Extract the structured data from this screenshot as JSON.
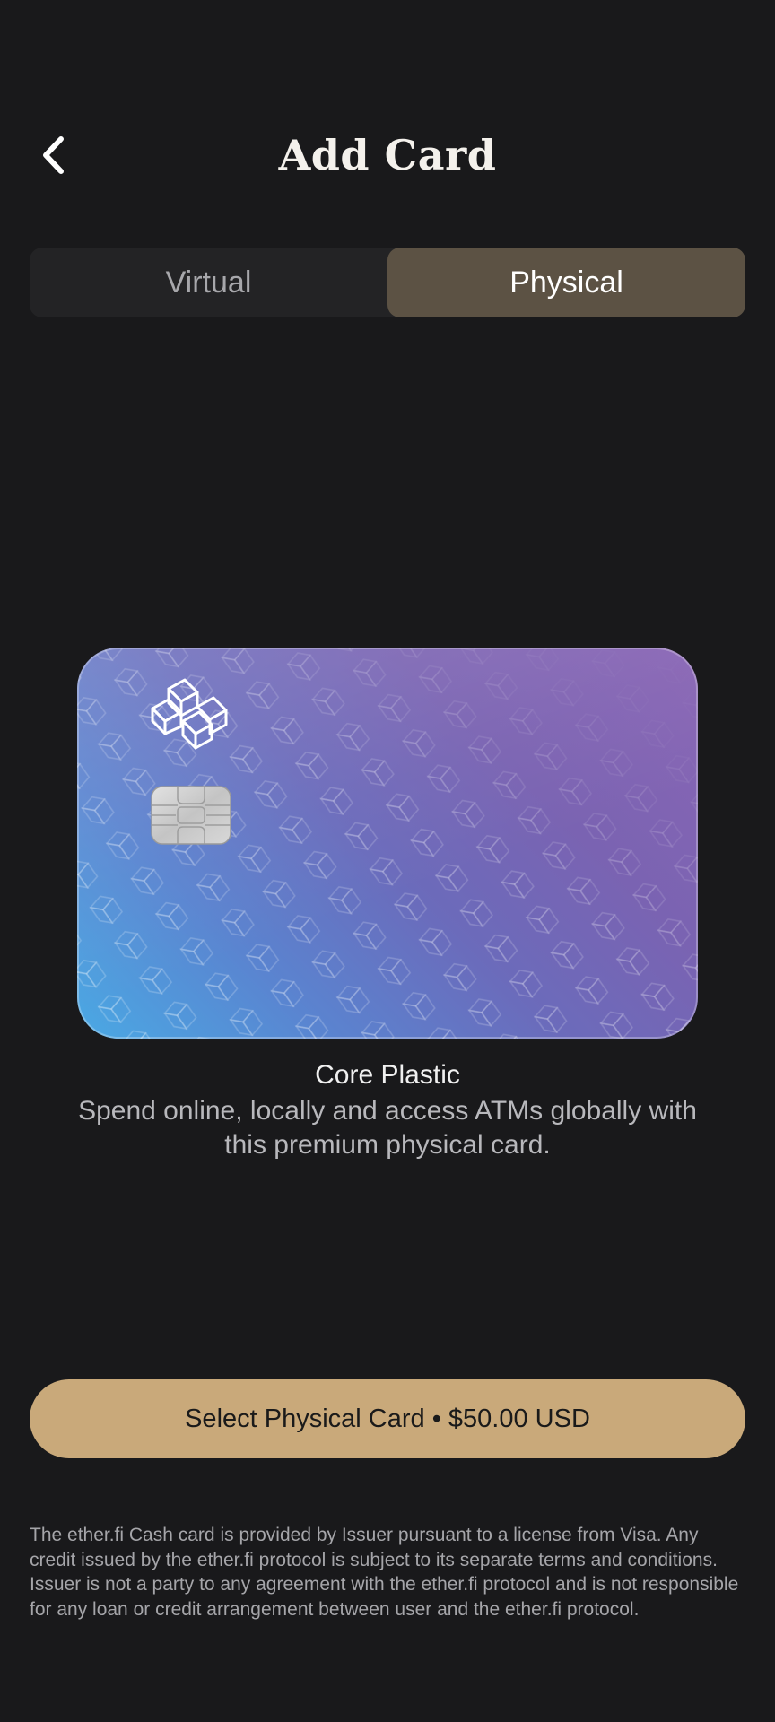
{
  "header": {
    "title": "Add Card",
    "back_icon": "chevron-left-icon"
  },
  "tabs": [
    {
      "label": "Virtual",
      "selected": false
    },
    {
      "label": "Physical",
      "selected": true
    }
  ],
  "card": {
    "logo_icon": "etherfi-logo-icon",
    "chip_icon": "card-chip-icon",
    "gradient_colors": [
      "#4aa9e4",
      "#6b6bbb",
      "#8a66b5"
    ],
    "name": "Core Plastic",
    "description": "Spend online, locally and access ATMs globally with this premium physical card."
  },
  "cta": {
    "label": "Select Physical Card • $50.00 USD",
    "color": "#c9a97a"
  },
  "legal_text": "The ether.fi Cash card is provided by Issuer pursuant to a license from Visa. Any credit issued by the ether.fi protocol is subject to its separate terms and conditions. Issuer is not a party to any agreement with the ether.fi protocol and is not responsible for any loan or credit arrangement between user and the ether.fi protocol.",
  "colors": {
    "background": "#19191b",
    "tab_active": "#5c5244",
    "tab_inactive": "#232325"
  }
}
